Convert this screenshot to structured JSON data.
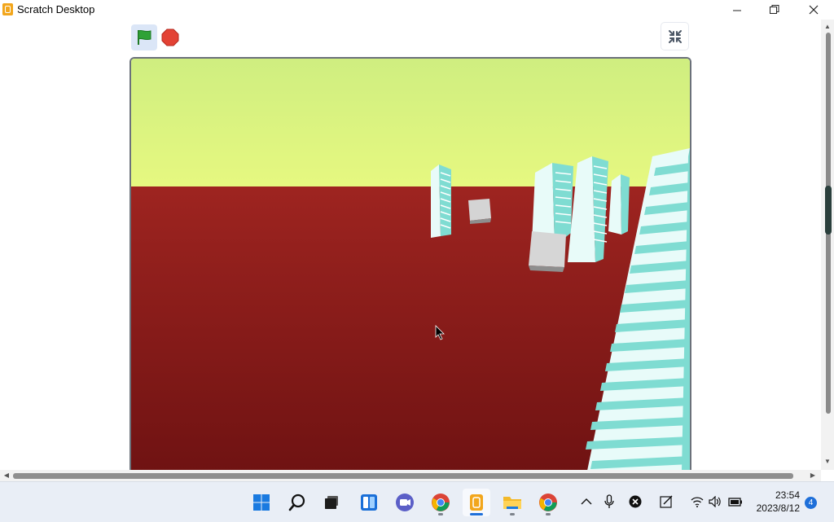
{
  "window": {
    "title": "Scratch Desktop",
    "minimize_glyph": "—",
    "restore_glyph": "❐",
    "close_glyph": "✕"
  },
  "stage_controls": {
    "green_flag_icon": "green-flag-icon",
    "stop_icon": "stop-sign-icon",
    "fullscreen_icon": "exit-fullscreen-icon"
  },
  "colors": {
    "sky": "#d9f27e",
    "ground": "#8e1e1a",
    "building": "#e6fbf8",
    "building_stripe": "#7dded3",
    "box": "#d2d2d2",
    "flag_green": "#2fa236",
    "stop_red": "#e34234",
    "accent": "#1e6fd9"
  },
  "taskbar": {
    "apps": [
      {
        "name": "Start",
        "icon": "windows-start-icon"
      },
      {
        "name": "Search",
        "icon": "search-icon"
      },
      {
        "name": "Task View",
        "icon": "task-view-icon"
      },
      {
        "name": "Widgets",
        "icon": "widgets-icon"
      },
      {
        "name": "Chat",
        "icon": "chat-icon"
      },
      {
        "name": "Chrome",
        "icon": "chrome-icon"
      },
      {
        "name": "Scratch Desktop",
        "icon": "scratch-icon"
      },
      {
        "name": "File Explorer",
        "icon": "folder-icon"
      },
      {
        "name": "Chrome",
        "icon": "chrome-icon"
      }
    ],
    "tray": {
      "chevron": "^",
      "notification_count": "4"
    },
    "clock": {
      "time": "23:54",
      "date": "2023/8/12"
    }
  }
}
